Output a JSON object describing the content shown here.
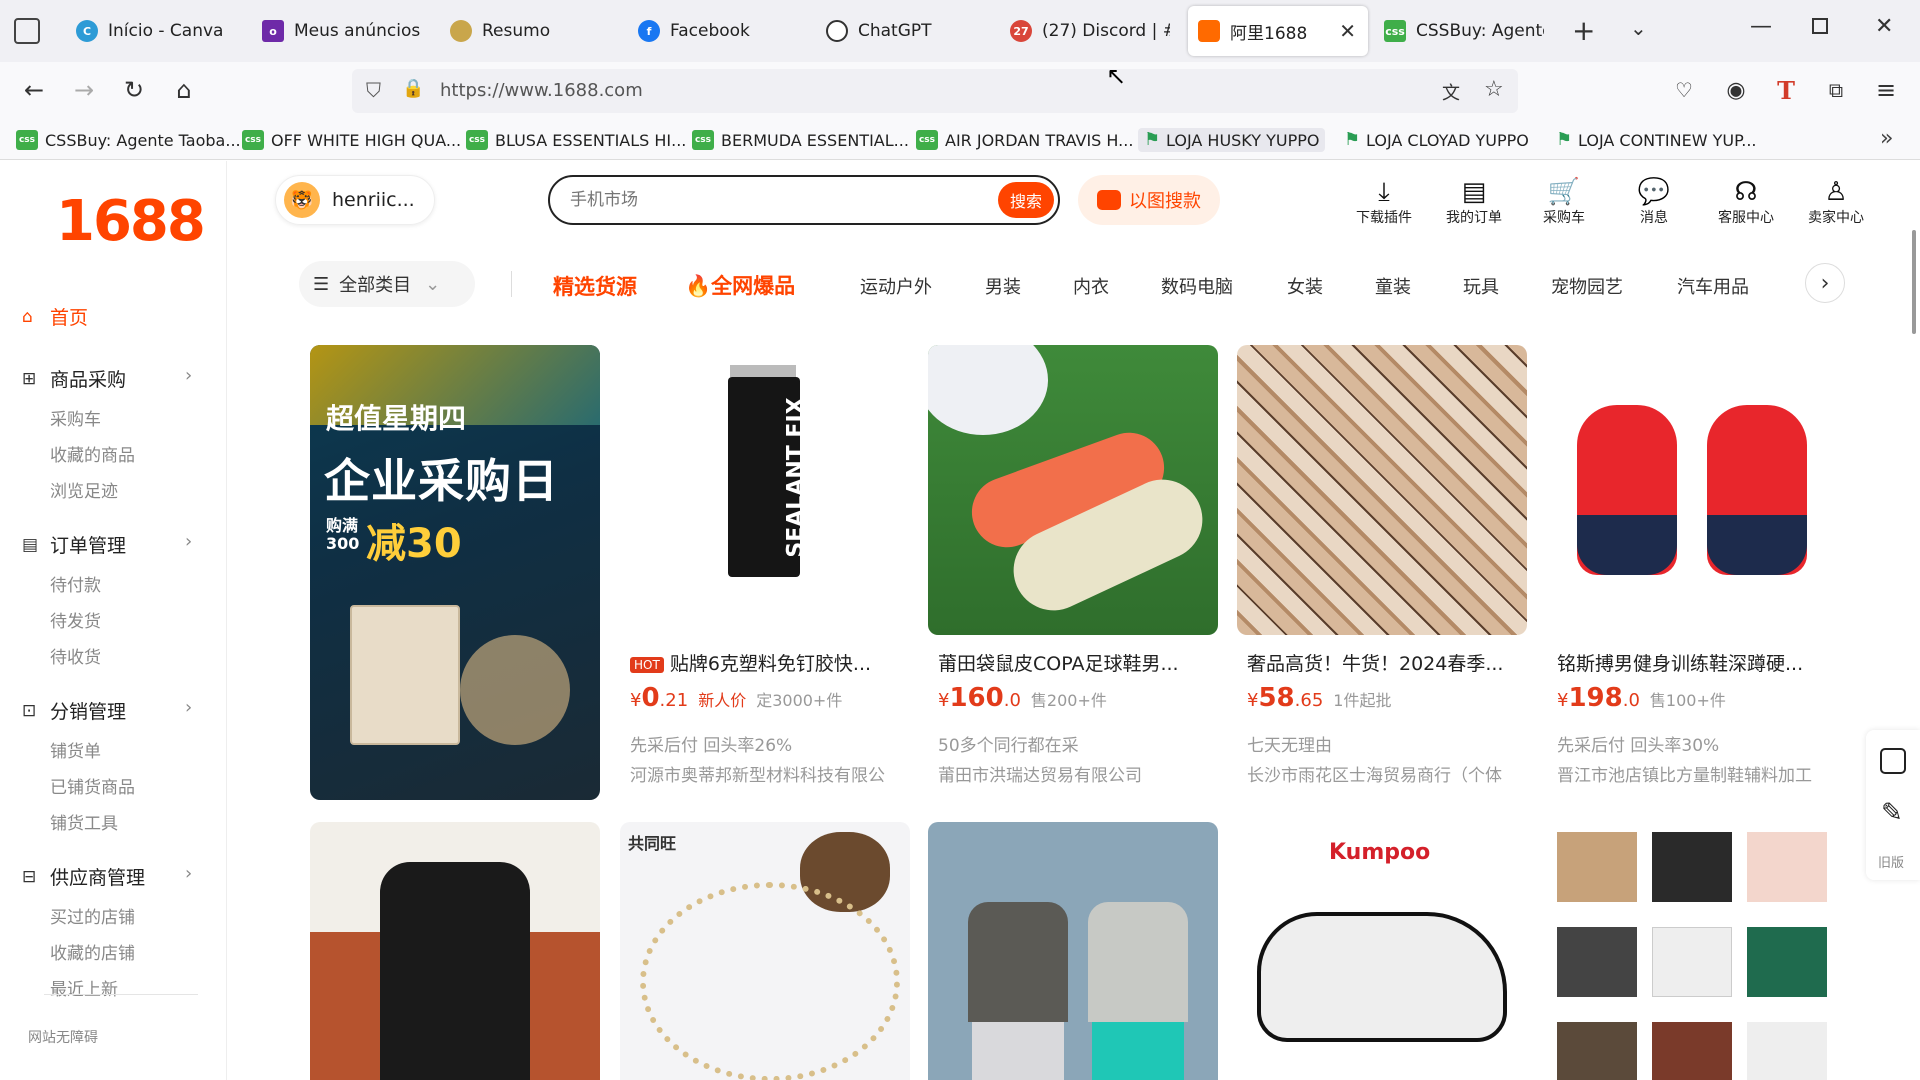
{
  "browser": {
    "tabs": [
      {
        "label": "Início - Canva",
        "icon": "canva-icon"
      },
      {
        "label": "Meus anúncios |",
        "icon": "olx-icon"
      },
      {
        "label": "Resumo",
        "icon": "resumo-icon"
      },
      {
        "label": "Facebook",
        "icon": "facebook-icon"
      },
      {
        "label": "ChatGPT",
        "icon": "chatgpt-icon"
      },
      {
        "label": "(27) Discord | #",
        "icon": "discord-icon"
      },
      {
        "label": "阿里1688",
        "icon": "alibaba-icon"
      },
      {
        "label": "CSSBuy: Agente",
        "icon": "cssbuy-icon"
      }
    ],
    "url": "https://www.1688.com",
    "bookmarks": [
      {
        "label": "CSSBuy: Agente Taoba..."
      },
      {
        "label": "OFF WHITE HIGH QUA..."
      },
      {
        "label": "BLUSA ESSENTIALS HI..."
      },
      {
        "label": "BERMUDA ESSENTIAL..."
      },
      {
        "label": "AIR JORDAN TRAVIS H..."
      },
      {
        "label": "LOJA HUSKY YUPPO"
      },
      {
        "label": "LOJA CLOYAD YUPPO"
      },
      {
        "label": "LOJA CONTINEW YUP..."
      }
    ]
  },
  "sidebar": {
    "logo": "1688",
    "home": "首页",
    "groups": [
      {
        "label": "商品采购",
        "items": [
          "采购车",
          "收藏的商品",
          "浏览足迹"
        ]
      },
      {
        "label": "订单管理",
        "items": [
          "待付款",
          "待发货",
          "待收货"
        ]
      },
      {
        "label": "分销管理",
        "items": [
          "铺货单",
          "已铺货商品",
          "铺货工具"
        ]
      },
      {
        "label": "供应商管理",
        "items": [
          "买过的店铺",
          "收藏的店铺",
          "最近上新"
        ]
      }
    ],
    "footer": "网站无障碍"
  },
  "header": {
    "username": "henriic...",
    "search_placeholder": "手机市场",
    "search_button": "搜索",
    "image_search": "以图搜款",
    "icons": [
      {
        "label": "下载插件",
        "glyph": "⤓"
      },
      {
        "label": "我的订单",
        "glyph": "▤"
      },
      {
        "label": "采购车",
        "glyph": "🛒"
      },
      {
        "label": "消息",
        "glyph": "💬"
      },
      {
        "label": "客服中心",
        "glyph": "☊"
      },
      {
        "label": "卖家中心",
        "glyph": "♙"
      }
    ]
  },
  "categories": {
    "all": "全部类目",
    "featured": "精选货源",
    "hot": "全网爆品",
    "items": [
      "运动户外",
      "男装",
      "内衣",
      "数码电脑",
      "女装",
      "童装",
      "玩具",
      "宠物园艺",
      "汽车用品"
    ]
  },
  "banner": {
    "line1": "超值星期四",
    "line2": "企业采购日",
    "small": "购满",
    "threshold": "300",
    "discount": "减30"
  },
  "products": [
    {
      "title": "贴牌6克塑料免钉胶快...",
      "hot": "HOT",
      "price_int": "0",
      "price_dec": ".21",
      "tag": "新人价",
      "note": "定3000+件",
      "line1": "先采后付  回头率26%",
      "line2": "河源市奥蒂邦新型材料科技有限公",
      "img_text": "SEALANT FIX"
    },
    {
      "title": "莆田袋鼠皮COPA足球鞋男...",
      "price_int": "160",
      "price_dec": ".0",
      "note": "售200+件",
      "line1": "50多个同行都在采",
      "line2": "莆田市洪瑞达贸易有限公司"
    },
    {
      "title": "奢品高货！牛货！2024春季...",
      "price_int": "58",
      "price_dec": ".65",
      "note": "1件起批",
      "line1": "七天无理由",
      "line2": "长沙市雨花区士海贸易商行（个体"
    },
    {
      "title": "铭斯搏男健身训练鞋深蹲硬...",
      "price_int": "198",
      "price_dec": ".0",
      "note": "售100+件",
      "line1": "先采后付  回头率30%",
      "line2": "晋江市池店镇比方量制鞋辅料加工"
    }
  ],
  "row2": {
    "brand_text": "Kumpoo",
    "chain_text": "共同旺"
  },
  "right_rail": {
    "old_version": "旧版"
  },
  "currency": "¥",
  "colors": {
    "accent": "#ff4400",
    "price": "#e23b1a"
  }
}
